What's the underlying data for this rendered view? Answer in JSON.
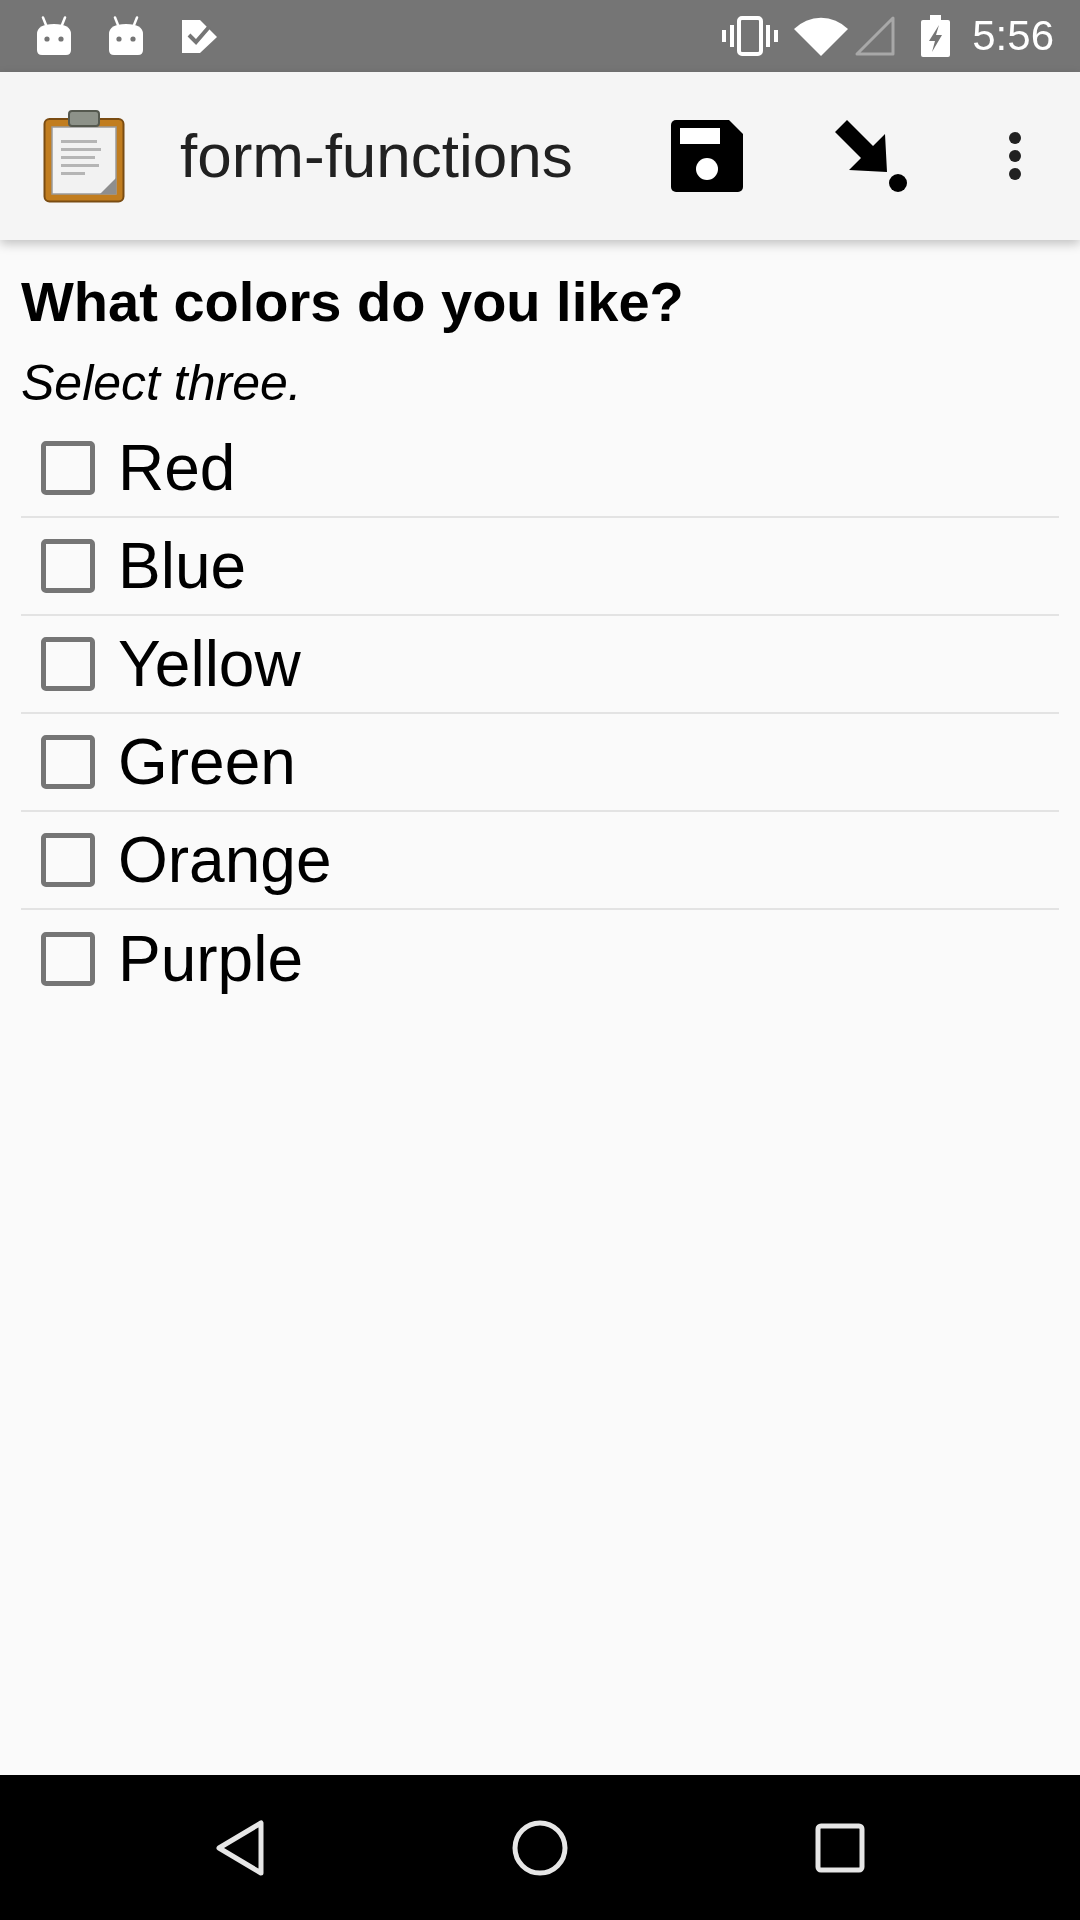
{
  "status_bar": {
    "time": "5:56"
  },
  "app_bar": {
    "title": "form-functions"
  },
  "question": {
    "label": "What colors do you like?",
    "hint": "Select three."
  },
  "options": [
    {
      "label": "Red",
      "checked": false
    },
    {
      "label": "Blue",
      "checked": false
    },
    {
      "label": "Yellow",
      "checked": false
    },
    {
      "label": "Green",
      "checked": false
    },
    {
      "label": "Orange",
      "checked": false
    },
    {
      "label": "Purple",
      "checked": false
    }
  ]
}
